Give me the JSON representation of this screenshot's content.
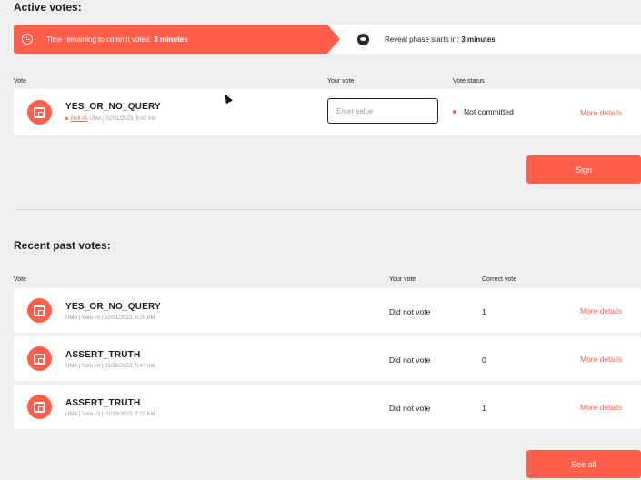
{
  "active": {
    "heading": "Active votes:",
    "commit_prefix": "Time remaining to commit votes:",
    "commit_time": "3 minutes",
    "reveal_prefix": "Reveal phase starts in:",
    "reveal_time": "3 minutes",
    "columns": {
      "vote": "Vote",
      "your_vote": "Your vote",
      "status": "Vote status"
    },
    "item": {
      "title": "YES_OR_NO_QUERY",
      "roll": "Roll #5",
      "meta": "UMA | 02/01/2023, 6:42 AM",
      "input_placeholder": "Enter value",
      "status": "Not committed",
      "more": "More details"
    },
    "sign_label": "Sign"
  },
  "past": {
    "heading": "Recent past votes:",
    "columns": {
      "vote": "Vote",
      "your_vote": "Your vote",
      "correct": "Correct vote"
    },
    "rows": [
      {
        "title": "YES_OR_NO_QUERY",
        "meta": "UMA | Vote #5 | 02/01/2023, 6:09 AM",
        "your_vote": "Did not vote",
        "correct": "1",
        "more": "More details"
      },
      {
        "title": "ASSERT_TRUTH",
        "meta": "UMA | Vote #4 | 01/26/2023, 5:47 AM",
        "your_vote": "Did not vote",
        "correct": "0",
        "more": "More details"
      },
      {
        "title": "ASSERT_TRUTH",
        "meta": "UMA | Vote #3 | 01/23/2023, 7:22 AM",
        "your_vote": "Did not vote",
        "correct": "1",
        "more": "More details"
      }
    ],
    "see_all_label": "See all"
  },
  "icons": {
    "commit": "clock-icon",
    "reveal": "eye-icon",
    "vote": "uma-logo-icon"
  },
  "colors": {
    "accent": "#ff5f4b",
    "background": "#efefef",
    "card": "#ffffff",
    "text": "#272528"
  }
}
